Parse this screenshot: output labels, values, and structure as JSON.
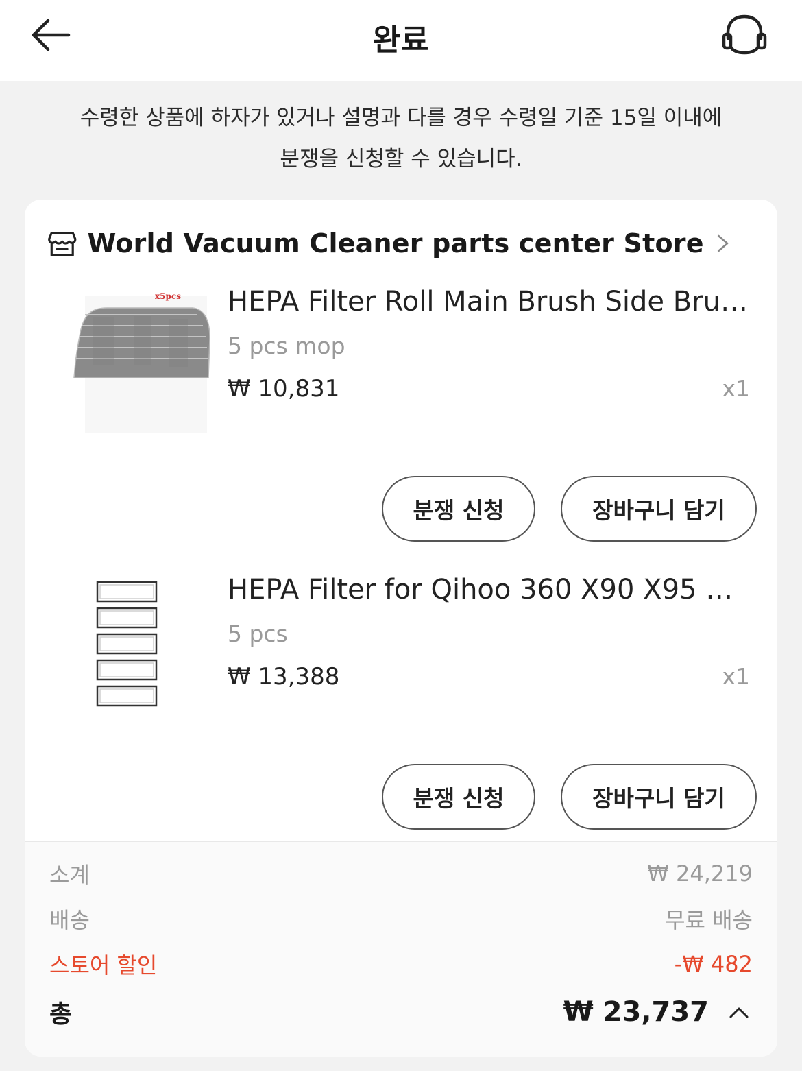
{
  "header": {
    "title": "완료",
    "back_icon": "arrow-left-icon",
    "support_icon": "headset-icon"
  },
  "notice": {
    "line1": "수령한 상품에 하자가 있거나 설명과 다를 경우 수령일 기준 15일 이내에",
    "line2": "분쟁을 신청할 수 있습니다."
  },
  "store": {
    "icon": "store-icon",
    "name": "World Vacuum Cleaner parts center Store"
  },
  "items": [
    {
      "title": "HEPA Filter Roll Main Brush Side Brus...",
      "variant": "5 pcs mop",
      "price": "₩ 10,831",
      "qty": "x1",
      "image_label": "x5pcs",
      "dispute_label": "분쟁 신청",
      "cart_label": "장바구니 담기"
    },
    {
      "title": "HEPA Filter for Qihoo 360 X90 X95 S9...",
      "variant": "5 pcs",
      "price": "₩ 13,388",
      "qty": "x1",
      "dispute_label": "분쟁 신청",
      "cart_label": "장바구니 담기"
    }
  ],
  "summary": {
    "subtotal_label": "소계",
    "subtotal_value": "₩ 24,219",
    "shipping_label": "배송",
    "shipping_value": "무료 배송",
    "discount_label": "스토어 할인",
    "discount_value": "-₩ 482",
    "total_label": "총",
    "total_value": "₩ 23,737"
  },
  "colors": {
    "discount": "#e6492d",
    "text": "#191919",
    "muted": "#9a9a9a"
  }
}
